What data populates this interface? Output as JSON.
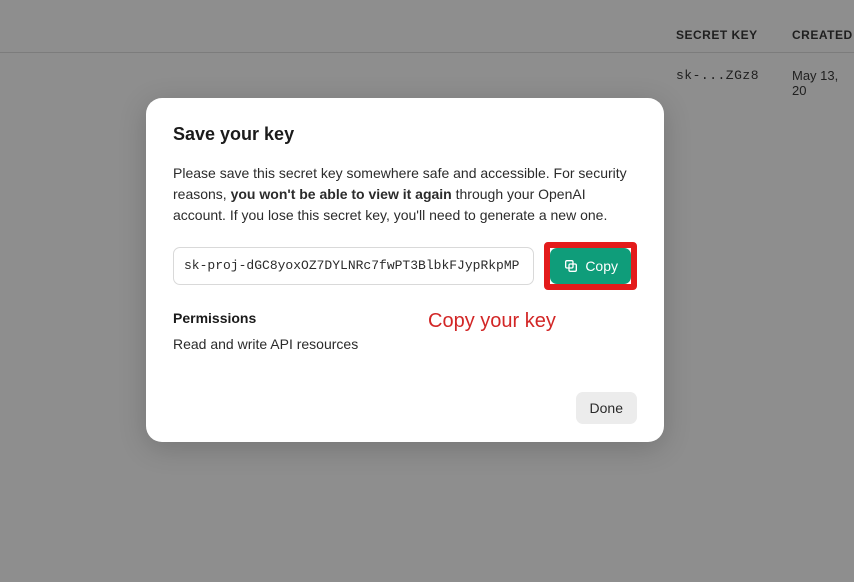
{
  "background": {
    "columns": {
      "secret": "SECRET KEY",
      "created": "CREATED"
    },
    "row": {
      "key": "sk-...ZGz8",
      "date": "May 13, 20"
    }
  },
  "modal": {
    "title": "Save your key",
    "desc_pre": "Please save this secret key somewhere safe and accessible. For security reasons, ",
    "desc_bold": "you won't be able to view it again",
    "desc_post": " through your OpenAI account. If you lose this secret key, you'll need to generate a new one.",
    "key_value": "sk-proj-dGC8yoxOZ7DYLNRc7fwPT3BlbkFJypRkpMP",
    "copy_label": "Copy",
    "permissions_title": "Permissions",
    "permissions_desc": "Read and write API resources",
    "done_label": "Done"
  },
  "annotation": {
    "text": "Copy your key"
  }
}
